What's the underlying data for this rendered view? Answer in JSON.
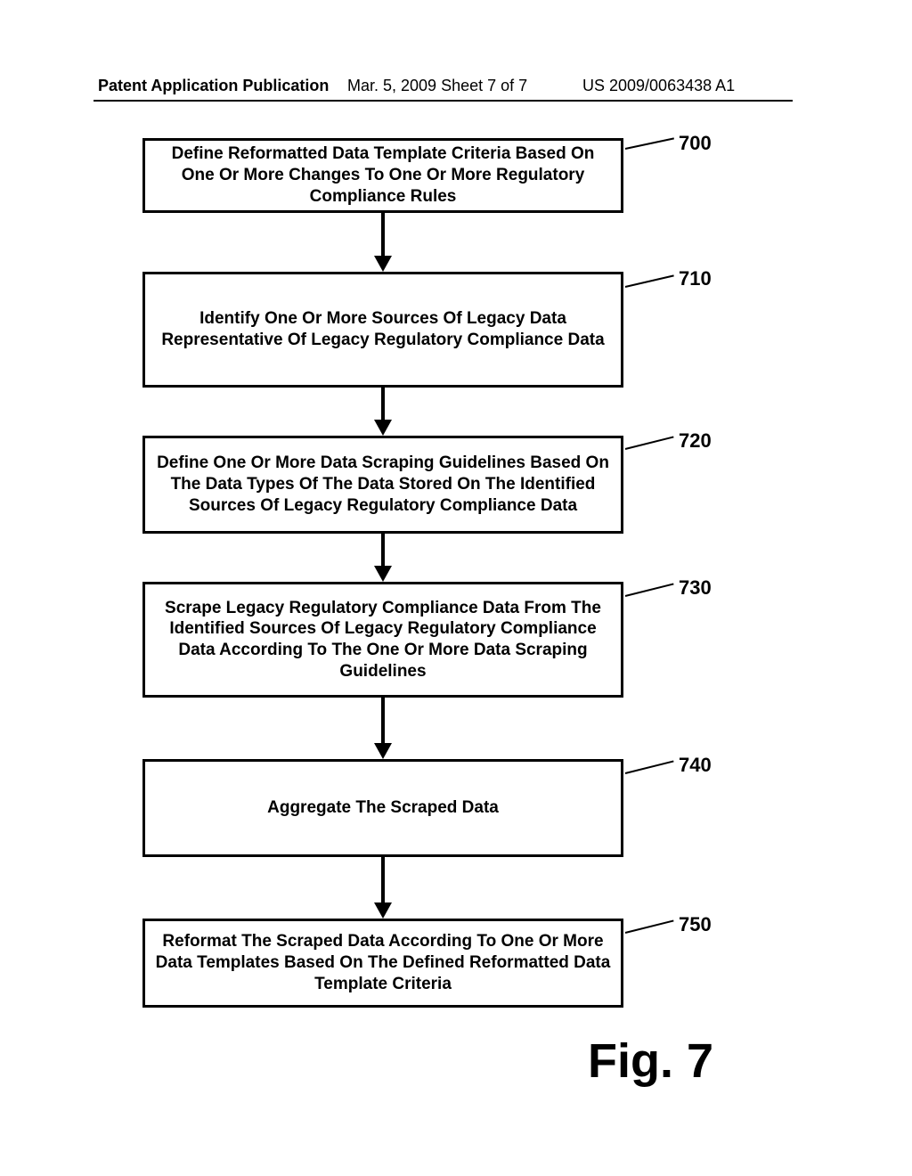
{
  "header": {
    "left": "Patent Application Publication",
    "mid": "Mar. 5, 2009  Sheet 7 of 7",
    "right": "US 2009/0063438 A1"
  },
  "steps": [
    {
      "ref": "700",
      "text": "Define Reformatted Data Template Criteria Based On One Or More Changes To One Or More Regulatory Compliance Rules"
    },
    {
      "ref": "710",
      "text": "Identify One Or More Sources Of Legacy Data Representative Of Legacy Regulatory Compliance Data"
    },
    {
      "ref": "720",
      "text": "Define One Or More Data Scraping Guidelines Based On The Data Types Of The Data Stored On The Identified Sources Of Legacy Regulatory Compliance Data"
    },
    {
      "ref": "730",
      "text": "Scrape Legacy Regulatory Compliance Data From The Identified Sources Of Legacy Regulatory Compliance Data According To The One Or More Data Scraping Guidelines"
    },
    {
      "ref": "740",
      "text": "Aggregate The Scraped Data"
    },
    {
      "ref": "750",
      "text": "Reformat The Scraped Data According To One Or More Data Templates Based On The Defined Reformatted Data Template Criteria"
    }
  ],
  "figure_label": "Fig. 7"
}
